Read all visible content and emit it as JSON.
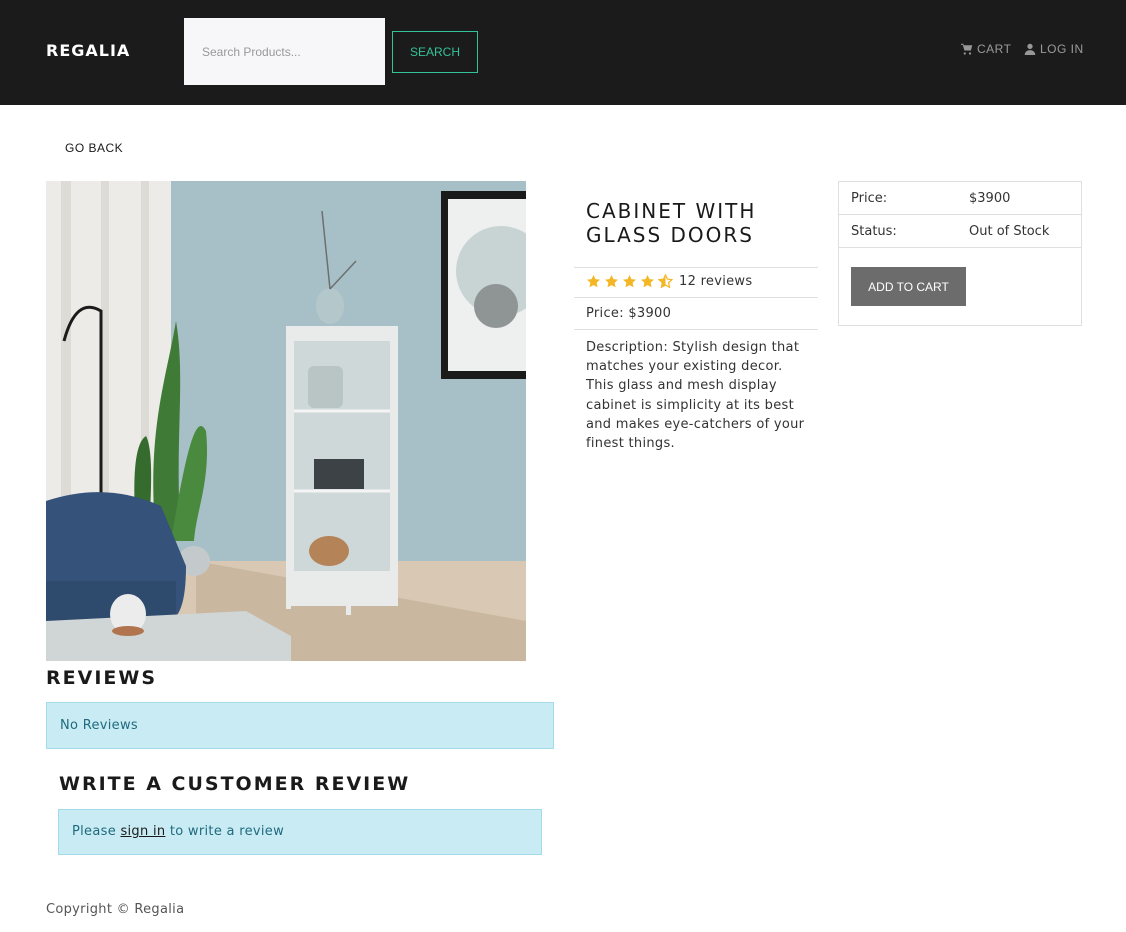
{
  "header": {
    "brand": "REGALIA",
    "search_placeholder": "Search Products...",
    "search_label": "SEARCH",
    "cart_label": "CART",
    "login_label": "LOG IN",
    "cart_icon": "shopping-cart-icon",
    "login_icon": "user-icon"
  },
  "nav": {
    "go_back": "GO BACK"
  },
  "product": {
    "title": "CABINET WITH GLASS DOORS",
    "rating": 4.5,
    "reviews_text": "12 reviews",
    "price_text": "Price: $3900",
    "description": "Description: Stylish design that matches your existing decor. This glass and mesh display cabinet is simplicity at its best and makes eye-catchers of your finest things."
  },
  "card": {
    "price_label": "Price:",
    "price_value": "$3900",
    "status_label": "Status:",
    "status_value": "Out of Stock",
    "add_to_cart": "ADD TO CART"
  },
  "reviews": {
    "title": "REVIEWS",
    "empty": "No Reviews",
    "write_title": "WRITE A CUSTOMER REVIEW",
    "signin_prefix": "Please",
    "signin_link": "sign in",
    "signin_suffix": "to write a review"
  },
  "footer": {
    "copyright": "Copyright © Regalia"
  },
  "colors": {
    "header_bg": "#1c1b1b",
    "accent": "#33c398",
    "star": "#f5b625",
    "alert_bg": "#c9ecf4"
  }
}
